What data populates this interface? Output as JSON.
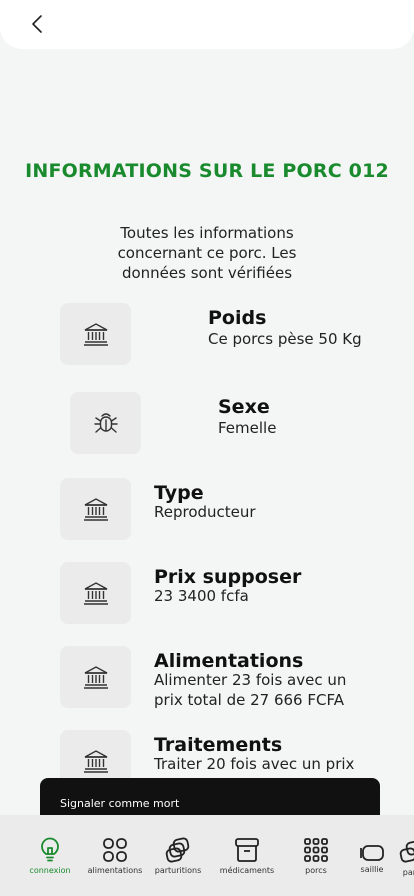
{
  "header": {
    "back_icon": "chevron-left-icon"
  },
  "title": "INFORMATIONS SUR LE PORC 012",
  "subtitle": "Toutes les informations concernant ce porc. Les données sont vérifiées",
  "items": [
    {
      "label": "Poids",
      "value": "Ce porcs pèse 50 Kg",
      "icon": "bank-icon"
    },
    {
      "label": "Sexe",
      "value": "Femelle",
      "icon": "bug-icon"
    },
    {
      "label": "Type",
      "value": "Reproducteur",
      "icon": "bank-icon"
    },
    {
      "label": "Prix supposer",
      "value": "23 3400 fcfa",
      "icon": "bank-icon"
    },
    {
      "label": "Alimentations",
      "value": "Alimenter 23 fois avec un prix total de 27 666 FCFA",
      "icon": "bank-icon"
    },
    {
      "label": "Traitements",
      "value": "Traiter 20 fois avec un prix",
      "icon": "bank-icon"
    }
  ],
  "toast": {
    "text": "Signaler comme mort"
  },
  "nav": [
    {
      "label": "connexion",
      "icon": "lightbulb-icon",
      "active": true
    },
    {
      "label": "alimentations",
      "icon": "grid-icon",
      "active": false
    },
    {
      "label": "parturitions",
      "icon": "layers-icon",
      "active": false
    },
    {
      "label": "médicaments",
      "icon": "archive-icon",
      "active": false
    },
    {
      "label": "porcs",
      "icon": "dots-grid-icon",
      "active": false
    },
    {
      "label": "saillie",
      "icon": "sliders-icon",
      "active": false
    },
    {
      "label": "part",
      "icon": "layers-icon",
      "active": false
    }
  ],
  "colors": {
    "accent": "#1a8a2e",
    "background": "#f3f6f4",
    "icon_box": "#ebebeb",
    "toast": "#111111"
  }
}
